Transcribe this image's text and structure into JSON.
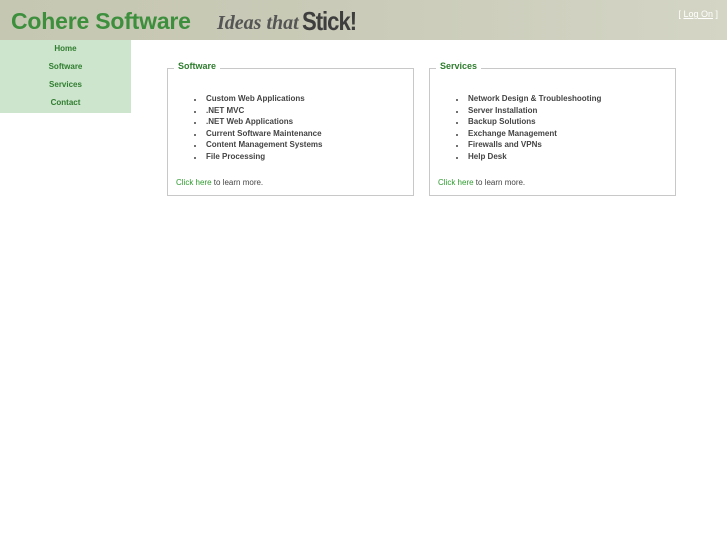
{
  "header": {
    "brand": "Cohere Software",
    "tagline_ideas": "Ideas that",
    "tagline_stick": "Stick!",
    "login_open": "[",
    "login_link": "Log On",
    "login_close": "]"
  },
  "nav": {
    "items": [
      {
        "label": "Home"
      },
      {
        "label": "Software"
      },
      {
        "label": "Services"
      },
      {
        "label": "Contact"
      }
    ]
  },
  "software": {
    "title": "Software",
    "items": [
      "Custom Web Applications",
      ".NET MVC",
      ".NET Web Applications",
      "Current Software Maintenance",
      "Content Management Systems",
      "File Processing"
    ],
    "link": "Click here",
    "link_suffix": " to learn more."
  },
  "services": {
    "title": "Services",
    "items": [
      "Network Design & Troubleshooting",
      "Server Installation",
      "Backup Solutions",
      "Exchange Management",
      "Firewalls and VPNs",
      "Help Desk"
    ],
    "link": "Click here",
    "link_suffix": " to learn more."
  },
  "colors": {
    "brand_green": "#3d8f3d",
    "nav_bg": "#cde4cd",
    "header_bg": "#c9cab7",
    "link_green": "#2f9b2f"
  }
}
